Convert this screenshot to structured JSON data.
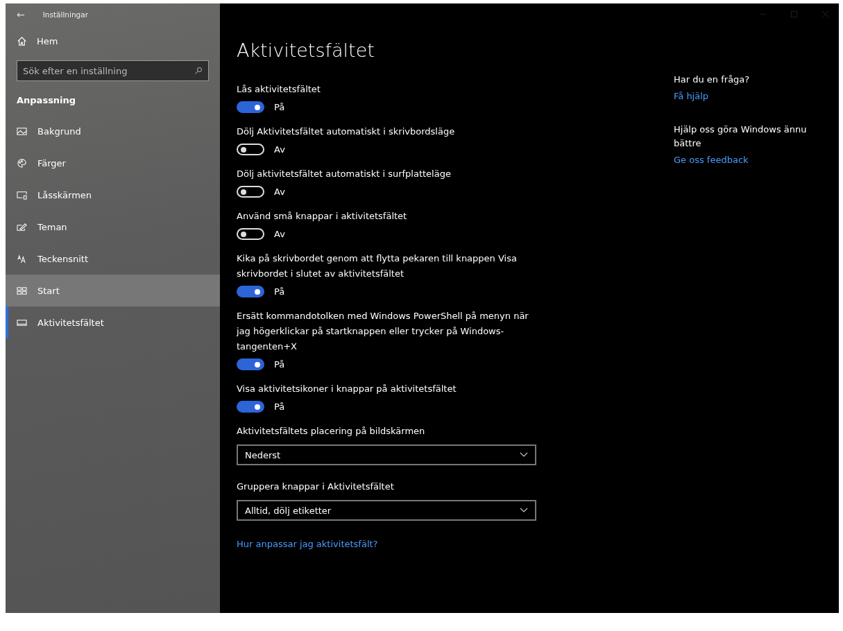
{
  "window": {
    "title": "Inställningar",
    "back": "←"
  },
  "sidebar": {
    "home": "Hem",
    "search": {
      "placeholder": "Sök efter en inställning"
    },
    "section": "Anpassning",
    "items": [
      {
        "label": "Bakgrund",
        "selected": false,
        "hovered": false
      },
      {
        "label": "Färger",
        "selected": false,
        "hovered": false
      },
      {
        "label": "Låsskärmen",
        "selected": false,
        "hovered": false
      },
      {
        "label": "Teman",
        "selected": false,
        "hovered": false
      },
      {
        "label": "Teckensnitt",
        "selected": false,
        "hovered": false
      },
      {
        "label": "Start",
        "selected": false,
        "hovered": true
      },
      {
        "label": "Aktivitetsfältet",
        "selected": true,
        "hovered": false
      }
    ]
  },
  "page": {
    "title": "Aktivitetsfältet",
    "settings": [
      {
        "kind": "toggle",
        "label": "Lås aktivitetsfältet",
        "on": true,
        "state": "På"
      },
      {
        "kind": "toggle",
        "label": "Dölj Aktivitetsfältet automatiskt i skrivbordsläge",
        "on": false,
        "state": "Av"
      },
      {
        "kind": "toggle",
        "label": "Dölj aktivitetsfältet automatiskt i surfplatteläge",
        "on": false,
        "state": "Av"
      },
      {
        "kind": "toggle",
        "label": "Använd små knappar i aktivitetsfältet",
        "on": false,
        "state": "Av"
      },
      {
        "kind": "toggle",
        "label": "Kika på skrivbordet genom att flytta pekaren till knappen Visa skrivbordet i slutet av aktivitetsfältet",
        "on": true,
        "state": "På"
      },
      {
        "kind": "toggle",
        "label": "Ersätt kommandotolken med Windows PowerShell på menyn när jag högerklickar på startknappen eller trycker på Windows-tangenten+X",
        "on": true,
        "state": "På"
      },
      {
        "kind": "toggle",
        "label": "Visa aktivitetsikoner i knappar på aktivitetsfältet",
        "on": true,
        "state": "På"
      },
      {
        "kind": "dropdown",
        "label": "Aktivitetsfältets placering på bildskärmen",
        "value": "Nederst"
      },
      {
        "kind": "dropdown",
        "label": "Gruppera knappar i Aktivitetsfältet",
        "value": "Alltid, dölj etiketter"
      }
    ],
    "link": "Hur anpassar jag aktivitetsfält?"
  },
  "help": [
    {
      "heading": "Har du en fråga?",
      "link": "Få hjälp"
    },
    {
      "heading": "Hjälp oss göra Windows ännu bättre",
      "link": "Ge oss feedback"
    }
  ]
}
